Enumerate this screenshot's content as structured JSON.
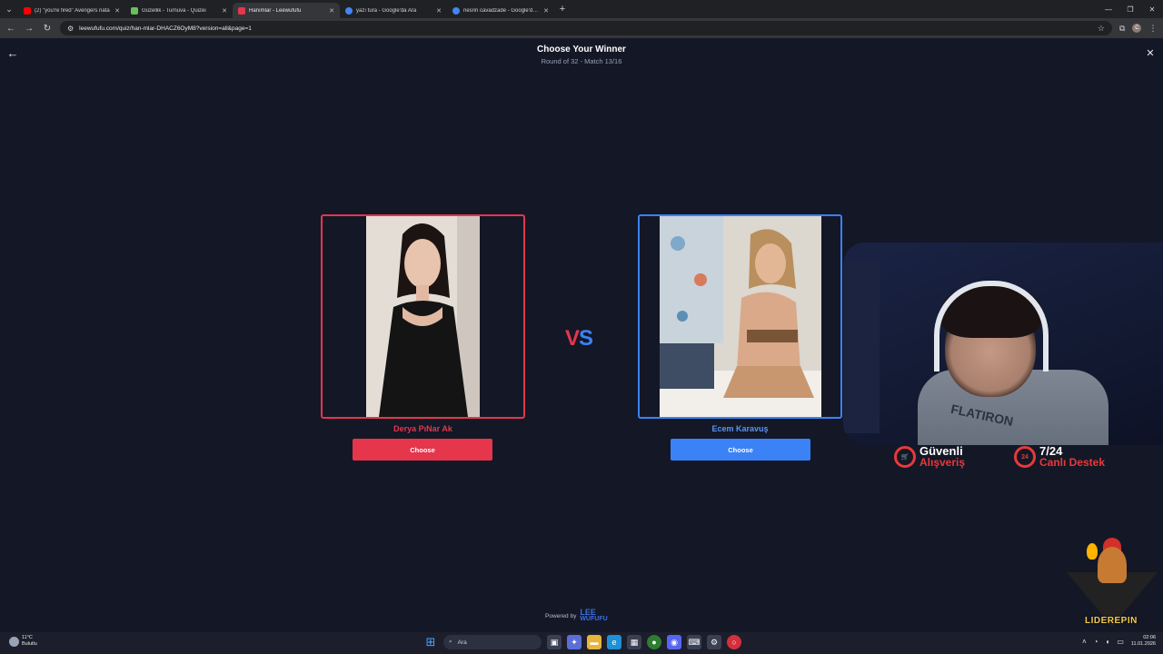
{
  "browser": {
    "tabs": [
      {
        "label": "(2) \"you're fired\" Avengers nata",
        "favicon_color": "#ff0000",
        "active": false
      },
      {
        "label": "Güzellik - Turnuva - Quizei",
        "favicon_color": "#6bbf59",
        "active": false
      },
      {
        "label": "Hanımlar - Leewufufu",
        "favicon_color": "#e5364c",
        "active": true
      },
      {
        "label": "yazı tura - Google'da Ara",
        "favicon_color": "#4285f4",
        "active": false
      },
      {
        "label": "nesrin cavadzade - Google'da A",
        "favicon_color": "#4285f4",
        "active": false
      }
    ],
    "url": "leewufufu.com/quiz/han-mlar-DHACZ6OyM8?version=all&page=1",
    "profile_initial": "C"
  },
  "page": {
    "title": "Choose Your Winner",
    "subtitle": "Round of 32 - Match 13/16",
    "vs_v": "V",
    "vs_s": "S",
    "left": {
      "name": "Derya PıNar Ak",
      "button": "Choose",
      "accent": "#e5364c"
    },
    "right": {
      "name": "Ecem Karavuş",
      "button": "Choose",
      "accent": "#3b82f6"
    },
    "powered_by": "Powered by",
    "logo_line1": "LEE",
    "logo_line2": "WUFUFU"
  },
  "overlay": {
    "shirt_text": "FLATIRON",
    "promo1_top": "Güvenli",
    "promo1_bottom": "Alışveriş",
    "promo2_top": "7/24",
    "promo2_bottom": "Canlı Destek",
    "promo2_badge": "24",
    "brand": "LIDEREPIN"
  },
  "taskbar": {
    "weather_temp": "11°C",
    "weather_desc": "Bulutlu",
    "search_placeholder": "Ara",
    "time": "02:06",
    "date": "11.01.2026"
  }
}
